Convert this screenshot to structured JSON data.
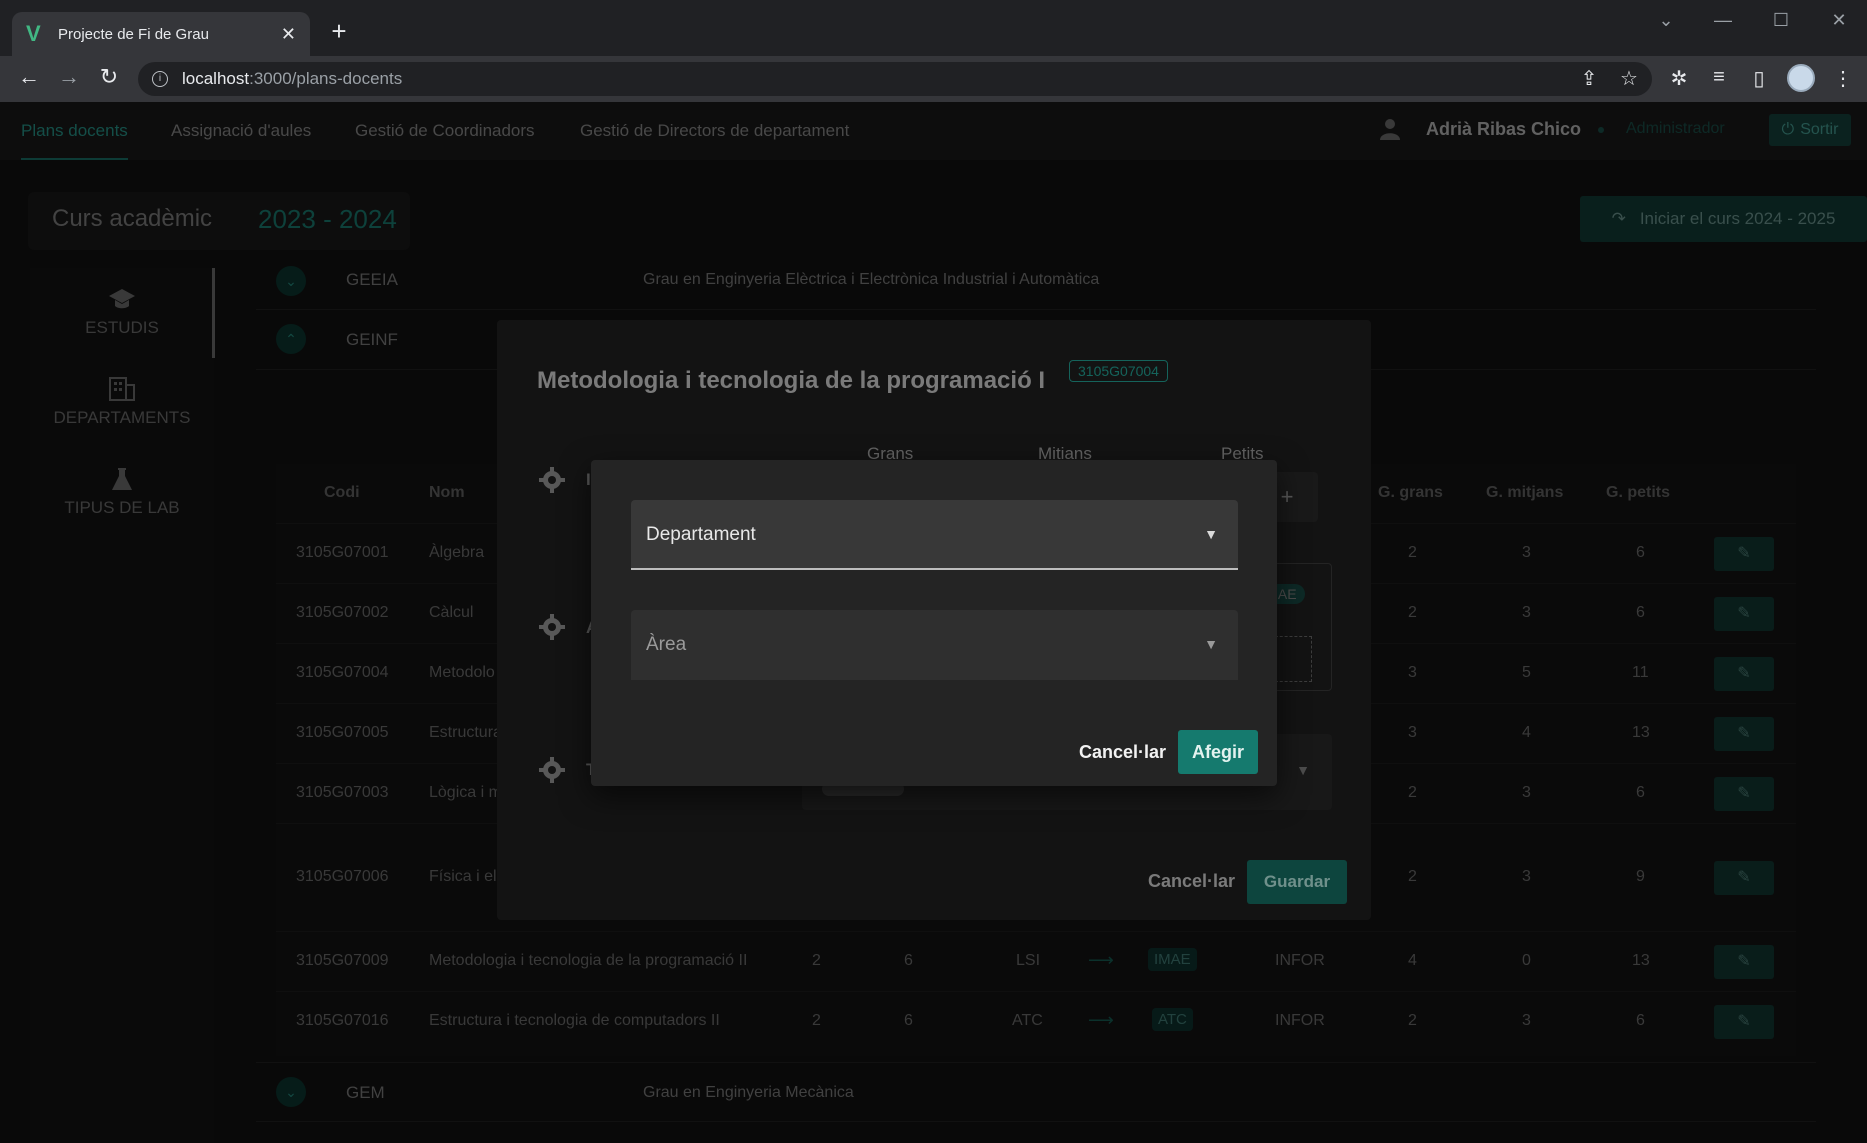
{
  "browser": {
    "tab_title": "Projecte de Fi de Grau",
    "url_host": "localhost",
    "url_path": ":3000/plans-docents"
  },
  "nav": {
    "tabs": [
      "Plans docents",
      "Assignació d'aules",
      "Gestió de Coordinadors",
      "Gestió de Directors de departament"
    ],
    "user_name": "Adrià Ribas Chico",
    "user_role": "Administrador",
    "logout": "Sortir"
  },
  "curs": {
    "label": "Curs acadèmic",
    "year": "2023 - 2024",
    "start_button": "Iniciar el curs 2024 - 2025"
  },
  "sidebar": {
    "items": [
      {
        "label": "ESTUDIS",
        "icon": "graduation-cap-icon"
      },
      {
        "label": "DEPARTAMENTS",
        "icon": "building-icon"
      },
      {
        "label": "TIPUS DE LAB",
        "icon": "flask-icon"
      }
    ]
  },
  "groups": [
    {
      "code": "GEEIA",
      "name": "Grau en Enginyeria Elèctrica i Electrònica Industrial i Automàtica"
    },
    {
      "code": "GEINF",
      "name": ""
    },
    {
      "code": "GEM",
      "name": "Grau en Enginyeria Mecànica"
    }
  ],
  "table": {
    "headers": {
      "codi": "Codi",
      "nom": "Nom",
      "grans": "G. grans",
      "mitjans": "G. mitjans",
      "petits": "G. petits"
    },
    "rows": [
      {
        "codi": "3105G07001",
        "nom": "Àlgebra",
        "grans": "2",
        "mitjans": "3",
        "petits": "6"
      },
      {
        "codi": "3105G07002",
        "nom": "Càlcul",
        "grans": "2",
        "mitjans": "3",
        "petits": "6"
      },
      {
        "codi": "3105G07004",
        "nom": "Metodolo",
        "grans": "3",
        "mitjans": "5",
        "petits": "11"
      },
      {
        "codi": "3105G07005",
        "nom": "Estructura",
        "grans": "3",
        "mitjans": "4",
        "petits": "13"
      },
      {
        "codi": "3105G07003",
        "nom": "Lògica i m",
        "grans": "2",
        "mitjans": "3",
        "petits": "6"
      },
      {
        "codi": "3105G07006",
        "nom": "Física i el",
        "grans": "2",
        "mitjans": "3",
        "petits": "9"
      },
      {
        "codi": "3105G07009",
        "nom": "Metodologia i tecnologia de la programació II",
        "c1": "2",
        "c2": "6",
        "dept": "LSI",
        "area": "IMAE",
        "est": "INFOR",
        "grans": "4",
        "mitjans": "0",
        "petits": "13"
      },
      {
        "codi": "3105G07016",
        "nom": "Estructura i tecnologia de computadors II",
        "c1": "2",
        "c2": "6",
        "dept": "ATC",
        "area": "ATC",
        "est": "INFOR",
        "grans": "2",
        "mitjans": "3",
        "petits": "6"
      }
    ]
  },
  "dialog": {
    "title": "Metodologia i tecnologia de la programació I",
    "code": "3105G07004",
    "col_grans": "Grans",
    "col_mitjans": "Mitians",
    "col_petits": "Petits",
    "peek1": "I",
    "peek2": "A",
    "peek3": "T",
    "chip_partial": "IAE",
    "plus": "+",
    "cancel": "Cancel·lar",
    "save": "Guardar"
  },
  "subdialog": {
    "departament": "Departament",
    "area": "Àrea",
    "cancel": "Cancel·lar",
    "add": "Afegir"
  }
}
